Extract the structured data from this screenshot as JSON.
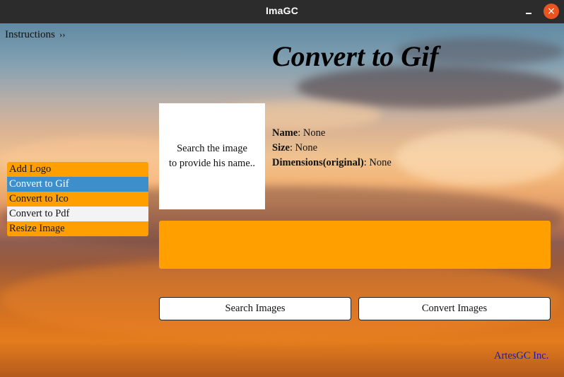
{
  "window": {
    "title": "ImaGC",
    "controls": {
      "minimize": "minimize-icon",
      "close": "close-icon"
    }
  },
  "instructions": {
    "label": "Instructions",
    "chevron": "››"
  },
  "heading": "Convert to Gif",
  "preview": {
    "line1": "Search the image",
    "line2": "to provide his name.."
  },
  "info": {
    "name_label": "Name",
    "name_value": ": None",
    "size_label": "Size",
    "size_value": ": None",
    "dimensions_label": "Dimensions(original)",
    "dimensions_value": ": None"
  },
  "menu": {
    "items": [
      {
        "label": "Add Logo"
      },
      {
        "label": "Convert to Gif"
      },
      {
        "label": "Convert to Ico"
      },
      {
        "label": "Convert to Pdf"
      },
      {
        "label": "Resize Image"
      }
    ],
    "selected": "Convert to Gif"
  },
  "buttons": {
    "search": "Search Images",
    "convert": "Convert Images"
  },
  "footer": "ArtesGC Inc.",
  "colors": {
    "accent": "#ffa000",
    "selected": "#3d8fcc",
    "close": "#e95420",
    "footer_link": "#1a1aa6"
  }
}
